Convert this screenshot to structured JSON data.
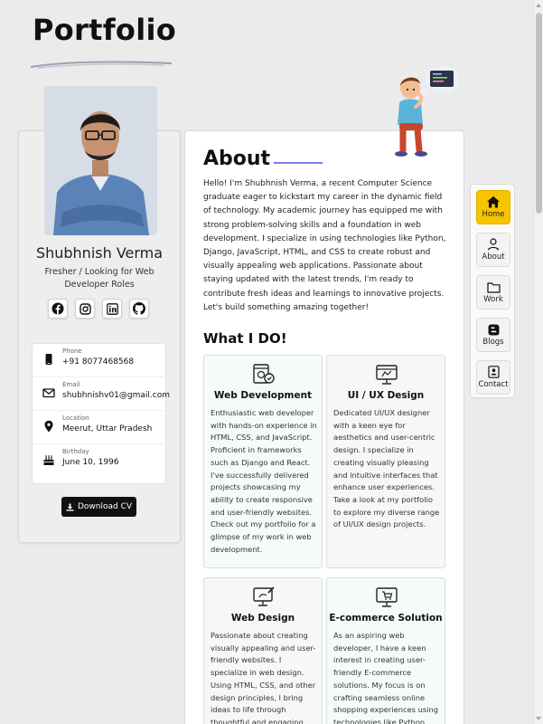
{
  "brand": {
    "logo": "Portfolio"
  },
  "profile": {
    "name": "Shubhnish Verma",
    "role": "Fresher / Looking for Web Developer Roles",
    "socials": [
      {
        "icon": "facebook-icon"
      },
      {
        "icon": "instagram-icon"
      },
      {
        "icon": "linkedin-icon"
      },
      {
        "icon": "github-icon"
      }
    ],
    "contacts": [
      {
        "icon": "phone-icon",
        "label": "Phone",
        "value": "+91 8077468568"
      },
      {
        "icon": "email-icon",
        "label": "Email",
        "value": "shubhnishv01@gmail.com"
      },
      {
        "icon": "location-pin-icon",
        "label": "Location",
        "value": "Meerut, Uttar Pradesh"
      },
      {
        "icon": "birthday-cake-icon",
        "label": "Birthday",
        "value": "June 10, 1996"
      }
    ],
    "download_cv": "Download CV"
  },
  "about": {
    "title": "About",
    "text": "Hello! I'm Shubhnish Verma, a recent Computer Science graduate eager to kickstart my career in the dynamic field of technology. My academic journey has equipped me with strong problem-solving skills and a foundation in web development. I specialize in using technologies like Python, Django, JavaScript, HTML, and CSS to create robust and visually appealing web applications. Passionate about staying updated with the latest trends, I'm ready to contribute fresh ideas and learnings to innovative projects. Let's build something amazing together!"
  },
  "services": {
    "title": "What I DO!",
    "items": [
      {
        "icon": "web-development-icon",
        "title": "Web Development",
        "text": "Enthusiastic web developer with hands-on experience in HTML, CSS, and JavaScript. Proficient in frameworks such as Django and React. I've successfully delivered projects showcasing my ability to create responsive and user-friendly websites. Check out my portfolio for a glimpse of my work in web development."
      },
      {
        "icon": "ui-ux-design-icon",
        "title": "UI / UX Design",
        "text": "Dedicated UI/UX designer with a keen eye for aesthetics and user-centric design. I specialize in creating visually pleasing and intuitive interfaces that enhance user experiences. Take a look at my portfolio to explore my diverse range of UI/UX design projects."
      },
      {
        "icon": "web-design-icon",
        "title": "Web Design",
        "text": "Passionate about creating visually appealing and user-friendly websites. I specialize in web design. Using HTML, CSS, and other design principles, I bring ideas to life through thoughtful and engaging website layouts."
      },
      {
        "icon": "ecommerce-icon",
        "title": "E-commerce Solution",
        "text": "As an aspiring web developer, I have a keen interest in creating user-friendly E-commerce solutions. My focus is on crafting seamless online shopping experiences using technologies like Python and"
      }
    ]
  },
  "nav": {
    "items": [
      {
        "icon": "home-icon",
        "label": "Home",
        "active": true
      },
      {
        "icon": "user-icon",
        "label": "About",
        "active": false
      },
      {
        "icon": "folder-icon",
        "label": "Work",
        "active": false
      },
      {
        "icon": "blog-icon",
        "label": "Blogs",
        "active": false
      },
      {
        "icon": "contact-card-icon",
        "label": "Contact",
        "active": false
      }
    ]
  },
  "colors": {
    "accent": "#f7c400",
    "about_underline": "#7b7bf0",
    "button": "#111111"
  }
}
